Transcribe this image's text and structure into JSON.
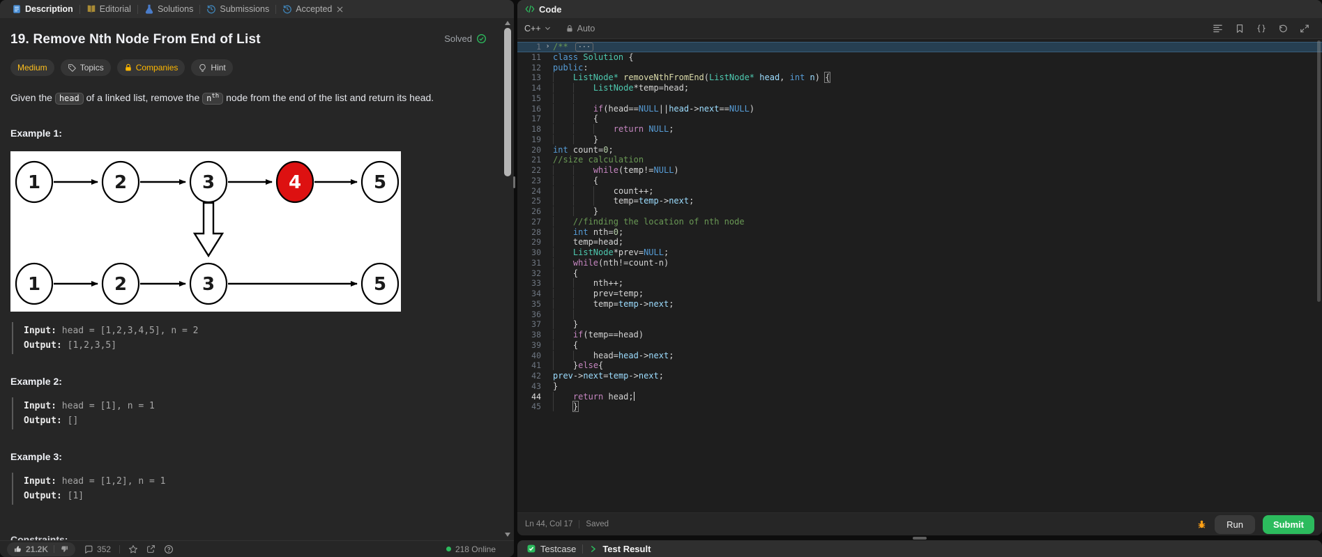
{
  "left_panel": {
    "tabs": [
      {
        "label": "Description",
        "icon": "description-icon",
        "active": true,
        "closable": false
      },
      {
        "label": "Editorial",
        "icon": "editorial-book-icon",
        "active": false,
        "closable": false
      },
      {
        "label": "Solutions",
        "icon": "solutions-flask-icon",
        "active": false,
        "closable": false
      },
      {
        "label": "Submissions",
        "icon": "submissions-history-icon",
        "active": false,
        "closable": false
      },
      {
        "label": "Accepted",
        "icon": "accepted-history-icon",
        "active": false,
        "closable": true
      }
    ],
    "problem": {
      "title": "19. Remove Nth Node From End of List",
      "solved_label": "Solved",
      "difficulty": "Medium",
      "meta_buttons": [
        {
          "label": "Topics",
          "icon": "tag-icon"
        },
        {
          "label": "Companies",
          "icon": "lock-icon"
        },
        {
          "label": "Hint",
          "icon": "bulb-icon"
        }
      ],
      "description_parts": [
        {
          "type": "text",
          "value": "Given the "
        },
        {
          "type": "code",
          "value": "head"
        },
        {
          "type": "text",
          "value": " of a linked list, remove the "
        },
        {
          "type": "code",
          "value": "n",
          "sup": "th"
        },
        {
          "type": "text",
          "value": " node from the end of the list and return its head."
        }
      ],
      "constraints_label": "Constraints:"
    },
    "examples": [
      {
        "heading": "Example 1:",
        "input_label": "Input:",
        "input": "head = [1,2,3,4,5], n = 2",
        "output_label": "Output:",
        "output": "[1,2,3,5]",
        "has_image": true
      },
      {
        "heading": "Example 2:",
        "input_label": "Input:",
        "input": "head = [1], n = 1",
        "output_label": "Output:",
        "output": "[]",
        "has_image": false
      },
      {
        "heading": "Example 3:",
        "input_label": "Input:",
        "input": "head = [1,2], n = 1",
        "output_label": "Output:",
        "output": "[1]",
        "has_image": false
      }
    ],
    "diagram": {
      "row1": [
        "1",
        "2",
        "3",
        "4",
        "5"
      ],
      "removed_index": 3,
      "arrow_under_index": 2,
      "row2": [
        "1",
        "2",
        "3",
        "5"
      ],
      "node_fill": "#ffffff",
      "removed_fill": "#dd1111",
      "stroke": "#000000"
    },
    "footer": {
      "likes": "21.2K",
      "comments": "352",
      "online": "218 Online"
    }
  },
  "editor_panel": {
    "header_label": "Code",
    "language": "C++",
    "auto_label": "Auto",
    "status": {
      "position": "Ln 44, Col 17",
      "saved": "Saved"
    },
    "run_label": "Run",
    "submit_label": "Submit",
    "lines": [
      {
        "n": "1",
        "fold": true,
        "hl": true,
        "t": [
          [
            "cmt",
            "/** "
          ],
          [
            "more",
            "···"
          ]
        ]
      },
      {
        "n": "11",
        "t": [
          [
            "kw",
            "class"
          ],
          [
            "pln",
            " "
          ],
          [
            "typ",
            "Solution"
          ],
          [
            "pln",
            " {"
          ]
        ]
      },
      {
        "n": "12",
        "t": [
          [
            "kw",
            "public"
          ],
          [
            "pln",
            ":"
          ]
        ]
      },
      {
        "n": "13",
        "t": [
          [
            "ind",
            "    "
          ],
          [
            "typ",
            "ListNode*"
          ],
          [
            "pln",
            " "
          ],
          [
            "fn",
            "removeNthFromEnd"
          ],
          [
            "pln",
            "("
          ],
          [
            "typ",
            "ListNode*"
          ],
          [
            "pln",
            " "
          ],
          [
            "vr",
            "head"
          ],
          [
            "pln",
            ", "
          ],
          [
            "kw",
            "int"
          ],
          [
            "pln",
            " "
          ],
          [
            "vr",
            "n"
          ],
          [
            "pln",
            ") "
          ],
          [
            "brk",
            "{"
          ]
        ]
      },
      {
        "n": "14",
        "t": [
          [
            "ind",
            "    "
          ],
          [
            "ind",
            "    "
          ],
          [
            "typ",
            "ListNode"
          ],
          [
            "pln",
            "*temp=head;"
          ]
        ]
      },
      {
        "n": "15",
        "t": [
          [
            "ind",
            "    "
          ],
          [
            "ind",
            "    "
          ]
        ]
      },
      {
        "n": "16",
        "t": [
          [
            "ind",
            "    "
          ],
          [
            "ind",
            "    "
          ],
          [
            "ctl",
            "if"
          ],
          [
            "pln",
            "(head=="
          ],
          [
            "kw",
            "NULL"
          ],
          [
            "pln",
            "||"
          ],
          [
            "vr",
            "head"
          ],
          [
            "pln",
            "->"
          ],
          [
            "vr",
            "next"
          ],
          [
            "pln",
            "=="
          ],
          [
            "kw",
            "NULL"
          ],
          [
            "pln",
            ")"
          ]
        ]
      },
      {
        "n": "17",
        "t": [
          [
            "ind",
            "    "
          ],
          [
            "ind",
            "    "
          ],
          [
            "pln",
            "{"
          ]
        ]
      },
      {
        "n": "18",
        "t": [
          [
            "ind",
            "    "
          ],
          [
            "ind",
            "    "
          ],
          [
            "ind",
            "    "
          ],
          [
            "ctl",
            "return"
          ],
          [
            "pln",
            " "
          ],
          [
            "kw",
            "NULL"
          ],
          [
            "pln",
            ";"
          ]
        ]
      },
      {
        "n": "19",
        "t": [
          [
            "ind",
            "    "
          ],
          [
            "ind",
            "    "
          ],
          [
            "pln",
            "}"
          ]
        ]
      },
      {
        "n": "20",
        "t": [
          [
            "kw",
            "int"
          ],
          [
            "pln",
            " count="
          ],
          [
            "num",
            "0"
          ],
          [
            "pln",
            ";"
          ]
        ]
      },
      {
        "n": "21",
        "t": [
          [
            "cmt",
            "//size calculation"
          ]
        ]
      },
      {
        "n": "22",
        "t": [
          [
            "ind",
            "    "
          ],
          [
            "ind",
            "    "
          ],
          [
            "ctl",
            "while"
          ],
          [
            "pln",
            "(temp!="
          ],
          [
            "kw",
            "NULL"
          ],
          [
            "pln",
            ")"
          ]
        ]
      },
      {
        "n": "23",
        "t": [
          [
            "ind",
            "    "
          ],
          [
            "ind",
            "    "
          ],
          [
            "pln",
            "{"
          ]
        ]
      },
      {
        "n": "24",
        "t": [
          [
            "ind",
            "    "
          ],
          [
            "ind",
            "    "
          ],
          [
            "ind",
            "    "
          ],
          [
            "pln",
            "count++;"
          ]
        ]
      },
      {
        "n": "25",
        "t": [
          [
            "ind",
            "    "
          ],
          [
            "ind",
            "    "
          ],
          [
            "ind",
            "    "
          ],
          [
            "pln",
            "temp="
          ],
          [
            "vr",
            "temp"
          ],
          [
            "pln",
            "->"
          ],
          [
            "vr",
            "next"
          ],
          [
            "pln",
            ";"
          ]
        ]
      },
      {
        "n": "26",
        "t": [
          [
            "ind",
            "    "
          ],
          [
            "ind",
            "    "
          ],
          [
            "pln",
            "}"
          ]
        ]
      },
      {
        "n": "27",
        "t": [
          [
            "ind",
            "    "
          ],
          [
            "cmt",
            "//finding the location of nth node"
          ]
        ]
      },
      {
        "n": "28",
        "t": [
          [
            "ind",
            "    "
          ],
          [
            "kw",
            "int"
          ],
          [
            "pln",
            " nth="
          ],
          [
            "num",
            "0"
          ],
          [
            "pln",
            ";"
          ]
        ]
      },
      {
        "n": "29",
        "t": [
          [
            "ind",
            "    "
          ],
          [
            "pln",
            "temp=head;"
          ]
        ]
      },
      {
        "n": "30",
        "t": [
          [
            "ind",
            "    "
          ],
          [
            "typ",
            "ListNode"
          ],
          [
            "pln",
            "*prev="
          ],
          [
            "kw",
            "NULL"
          ],
          [
            "pln",
            ";"
          ]
        ]
      },
      {
        "n": "31",
        "t": [
          [
            "ind",
            "    "
          ],
          [
            "ctl",
            "while"
          ],
          [
            "pln",
            "(nth!=count-n)"
          ]
        ]
      },
      {
        "n": "32",
        "t": [
          [
            "ind",
            "    "
          ],
          [
            "pln",
            "{"
          ]
        ]
      },
      {
        "n": "33",
        "t": [
          [
            "ind",
            "    "
          ],
          [
            "ind",
            "    "
          ],
          [
            "pln",
            "nth++;"
          ]
        ]
      },
      {
        "n": "34",
        "t": [
          [
            "ind",
            "    "
          ],
          [
            "ind",
            "    "
          ],
          [
            "pln",
            "prev=temp;"
          ]
        ]
      },
      {
        "n": "35",
        "t": [
          [
            "ind",
            "    "
          ],
          [
            "ind",
            "    "
          ],
          [
            "pln",
            "temp="
          ],
          [
            "vr",
            "temp"
          ],
          [
            "pln",
            "->"
          ],
          [
            "vr",
            "next"
          ],
          [
            "pln",
            ";"
          ]
        ]
      },
      {
        "n": "36",
        "t": [
          [
            "ind",
            "    "
          ],
          [
            "ind",
            "    "
          ]
        ]
      },
      {
        "n": "37",
        "t": [
          [
            "ind",
            "    "
          ],
          [
            "pln",
            "}"
          ]
        ]
      },
      {
        "n": "38",
        "t": [
          [
            "ind",
            "    "
          ],
          [
            "ctl",
            "if"
          ],
          [
            "pln",
            "(temp==head)"
          ]
        ]
      },
      {
        "n": "39",
        "t": [
          [
            "ind",
            "    "
          ],
          [
            "pln",
            "{"
          ]
        ]
      },
      {
        "n": "40",
        "t": [
          [
            "ind",
            "    "
          ],
          [
            "ind",
            "    "
          ],
          [
            "pln",
            "head="
          ],
          [
            "vr",
            "head"
          ],
          [
            "pln",
            "->"
          ],
          [
            "vr",
            "next"
          ],
          [
            "pln",
            ";"
          ]
        ]
      },
      {
        "n": "41",
        "t": [
          [
            "ind",
            "    "
          ],
          [
            "pln",
            "}"
          ],
          [
            "ctl",
            "else"
          ],
          [
            "pln",
            "{"
          ]
        ]
      },
      {
        "n": "42",
        "t": [
          [
            "vr",
            "prev"
          ],
          [
            "pln",
            "->"
          ],
          [
            "vr",
            "next"
          ],
          [
            "pln",
            "="
          ],
          [
            "vr",
            "temp"
          ],
          [
            "pln",
            "->"
          ],
          [
            "vr",
            "next"
          ],
          [
            "pln",
            ";"
          ]
        ]
      },
      {
        "n": "43",
        "t": [
          [
            "pln",
            "}"
          ]
        ]
      },
      {
        "n": "44",
        "active": true,
        "t": [
          [
            "ind",
            "    "
          ],
          [
            "ctl",
            "return"
          ],
          [
            "pln",
            " head;"
          ],
          [
            "cur",
            ""
          ]
        ]
      },
      {
        "n": "45",
        "t": [
          [
            "ind",
            "    "
          ],
          [
            "brk",
            "}"
          ]
        ]
      }
    ]
  },
  "bottom_panel": {
    "testcase_label": "Testcase",
    "test_result_label": "Test Result"
  },
  "colors": {
    "accent_green": "#2cbb5d",
    "medium_yellow": "#ffc01e",
    "companies_gold": "#ffb800",
    "debug_orange": "#ffa116",
    "diagram_red": "#dd1111"
  }
}
